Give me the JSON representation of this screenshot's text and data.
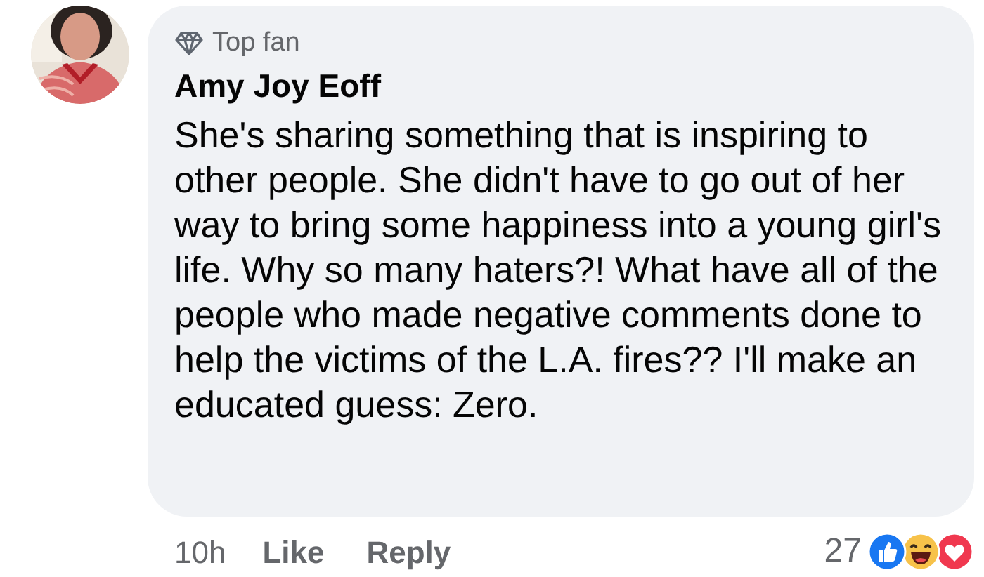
{
  "comment": {
    "badge": "Top fan",
    "author": "Amy Joy Eoff",
    "text": "She's sharing something that is inspiring to other people. She didn't have to go out of her way to bring some happiness into a young girl's life. Why so many haters?! What have all of the people who made negative comments done to help the victims of the L.A. fires?? I'll make an educated guess: Zero.",
    "time": "10h",
    "actions": [
      "Like",
      "Reply"
    ],
    "reaction_count": "27"
  }
}
